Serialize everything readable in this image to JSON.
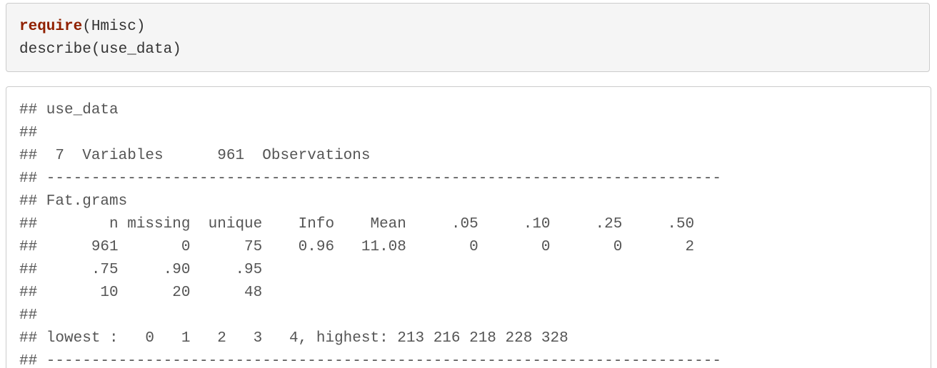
{
  "code": {
    "line1_keyword": "require",
    "line1_rest": "(Hmisc)",
    "line2": "describe(use_data)"
  },
  "output": {
    "lines": [
      "## use_data",
      "##",
      "##  7  Variables      961  Observations",
      "## ---------------------------------------------------------------------------",
      "## Fat.grams",
      "##        n missing  unique    Info    Mean     .05     .10     .25     .50",
      "##      961       0      75    0.96   11.08       0       0       0       2",
      "##      .75     .90     .95",
      "##       10      20      48",
      "##",
      "## lowest :   0   1   2   3   4, highest: 213 216 218 228 328",
      "## ---------------------------------------------------------------------------"
    ]
  }
}
